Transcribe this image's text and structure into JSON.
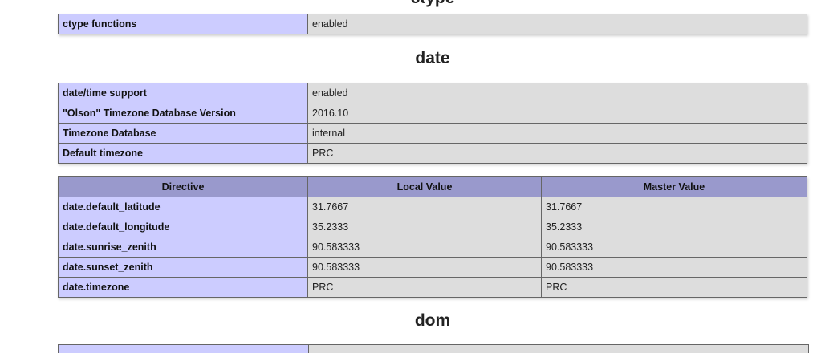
{
  "previous_section": {
    "heading": "ctype",
    "rows": [
      {
        "name": "ctype functions",
        "value": "enabled"
      }
    ]
  },
  "date_section": {
    "heading": "date",
    "info_rows": [
      {
        "name": "date/time support",
        "value": "enabled"
      },
      {
        "name": "\"Olson\" Timezone Database Version",
        "value": "2016.10"
      },
      {
        "name": "Timezone Database",
        "value": "internal"
      },
      {
        "name": "Default timezone",
        "value": "PRC"
      }
    ],
    "directives": {
      "headers": [
        "Directive",
        "Local Value",
        "Master Value"
      ],
      "rows": [
        {
          "directive": "date.default_latitude",
          "local": "31.7667",
          "master": "31.7667"
        },
        {
          "directive": "date.default_longitude",
          "local": "35.2333",
          "master": "35.2333"
        },
        {
          "directive": "date.sunrise_zenith",
          "local": "90.583333",
          "master": "90.583333"
        },
        {
          "directive": "date.sunset_zenith",
          "local": "90.583333",
          "master": "90.583333"
        },
        {
          "directive": "date.timezone",
          "local": "PRC",
          "master": "PRC"
        }
      ]
    }
  },
  "next_section": {
    "heading": "dom"
  },
  "colors": {
    "entry_bg": "#ccccff",
    "value_bg": "#dddddd",
    "header_bg": "#9999cc",
    "border": "#666666"
  }
}
